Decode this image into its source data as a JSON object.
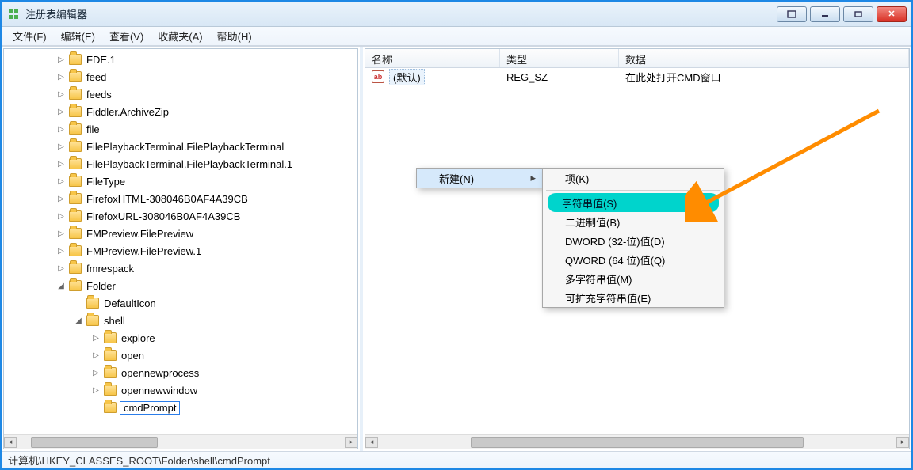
{
  "window": {
    "title": "注册表编辑器"
  },
  "menubar": [
    "文件(F)",
    "编辑(E)",
    "查看(V)",
    "收藏夹(A)",
    "帮助(H)"
  ],
  "tree": [
    {
      "indent": 3,
      "exp": "▷",
      "label": "FDE.1"
    },
    {
      "indent": 3,
      "exp": "▷",
      "label": "feed"
    },
    {
      "indent": 3,
      "exp": "▷",
      "label": "feeds"
    },
    {
      "indent": 3,
      "exp": "▷",
      "label": "Fiddler.ArchiveZip"
    },
    {
      "indent": 3,
      "exp": "▷",
      "label": "file"
    },
    {
      "indent": 3,
      "exp": "▷",
      "label": "FilePlaybackTerminal.FilePlaybackTerminal"
    },
    {
      "indent": 3,
      "exp": "▷",
      "label": "FilePlaybackTerminal.FilePlaybackTerminal.1"
    },
    {
      "indent": 3,
      "exp": "▷",
      "label": "FileType"
    },
    {
      "indent": 3,
      "exp": "▷",
      "label": "FirefoxHTML-308046B0AF4A39CB"
    },
    {
      "indent": 3,
      "exp": "▷",
      "label": "FirefoxURL-308046B0AF4A39CB"
    },
    {
      "indent": 3,
      "exp": "▷",
      "label": "FMPreview.FilePreview"
    },
    {
      "indent": 3,
      "exp": "▷",
      "label": "FMPreview.FilePreview.1"
    },
    {
      "indent": 3,
      "exp": "▷",
      "label": "fmrespack"
    },
    {
      "indent": 3,
      "exp": "◢",
      "label": "Folder"
    },
    {
      "indent": 4,
      "exp": "",
      "label": "DefaultIcon"
    },
    {
      "indent": 4,
      "exp": "◢",
      "label": "shell"
    },
    {
      "indent": 5,
      "exp": "▷",
      "label": "explore"
    },
    {
      "indent": 5,
      "exp": "▷",
      "label": "open"
    },
    {
      "indent": 5,
      "exp": "▷",
      "label": "opennewprocess"
    },
    {
      "indent": 5,
      "exp": "▷",
      "label": "opennewwindow"
    },
    {
      "indent": 5,
      "exp": "",
      "label": "cmdPrompt",
      "editing": true
    }
  ],
  "grid": {
    "headers": {
      "name": "名称",
      "type": "类型",
      "data": "数据"
    },
    "rows": [
      {
        "icon": "ab",
        "name": "(默认)",
        "type": "REG_SZ",
        "data": "在此处打开CMD窗口",
        "selected": true
      }
    ]
  },
  "context": {
    "menu": {
      "label": "新建(N)"
    },
    "submenu": [
      {
        "label": "项(K)"
      },
      {
        "sep": true
      },
      {
        "label": "字符串值(S)",
        "hl": true
      },
      {
        "label": "二进制值(B)"
      },
      {
        "label": "DWORD (32-位)值(D)"
      },
      {
        "label": "QWORD (64 位)值(Q)"
      },
      {
        "label": "多字符串值(M)"
      },
      {
        "label": "可扩充字符串值(E)"
      }
    ]
  },
  "statusbar": "计算机\\HKEY_CLASSES_ROOT\\Folder\\shell\\cmdPrompt"
}
